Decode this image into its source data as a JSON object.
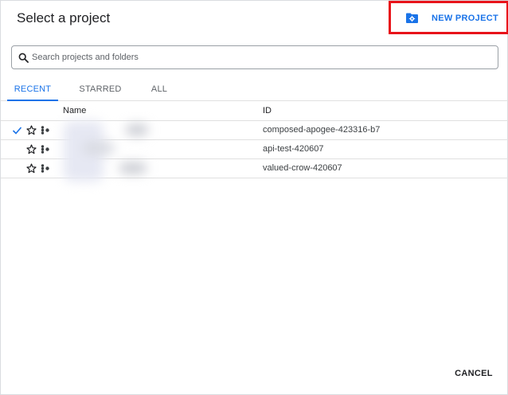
{
  "dialog": {
    "title": "Select a project",
    "new_project_label": "NEW PROJECT",
    "cancel_label": "CANCEL"
  },
  "search": {
    "placeholder": "Search projects and folders",
    "value": ""
  },
  "tabs": [
    {
      "label": "RECENT",
      "active": true
    },
    {
      "label": "STARRED",
      "active": false
    },
    {
      "label": "ALL",
      "active": false
    }
  ],
  "table": {
    "headers": {
      "name": "Name",
      "id": "ID"
    },
    "rows": [
      {
        "selected": true,
        "id": "composed-apogee-423316-b7"
      },
      {
        "selected": false,
        "id": "api-test-420607"
      },
      {
        "selected": false,
        "id": "valued-crow-420607"
      }
    ]
  },
  "icons": {
    "new_project": "folder-gear-icon",
    "search": "search-icon",
    "check": "check-icon",
    "star": "star-outline-icon",
    "org": "organization-icon"
  },
  "colors": {
    "accent": "#1a73e8",
    "highlight_box": "#e8131a"
  }
}
